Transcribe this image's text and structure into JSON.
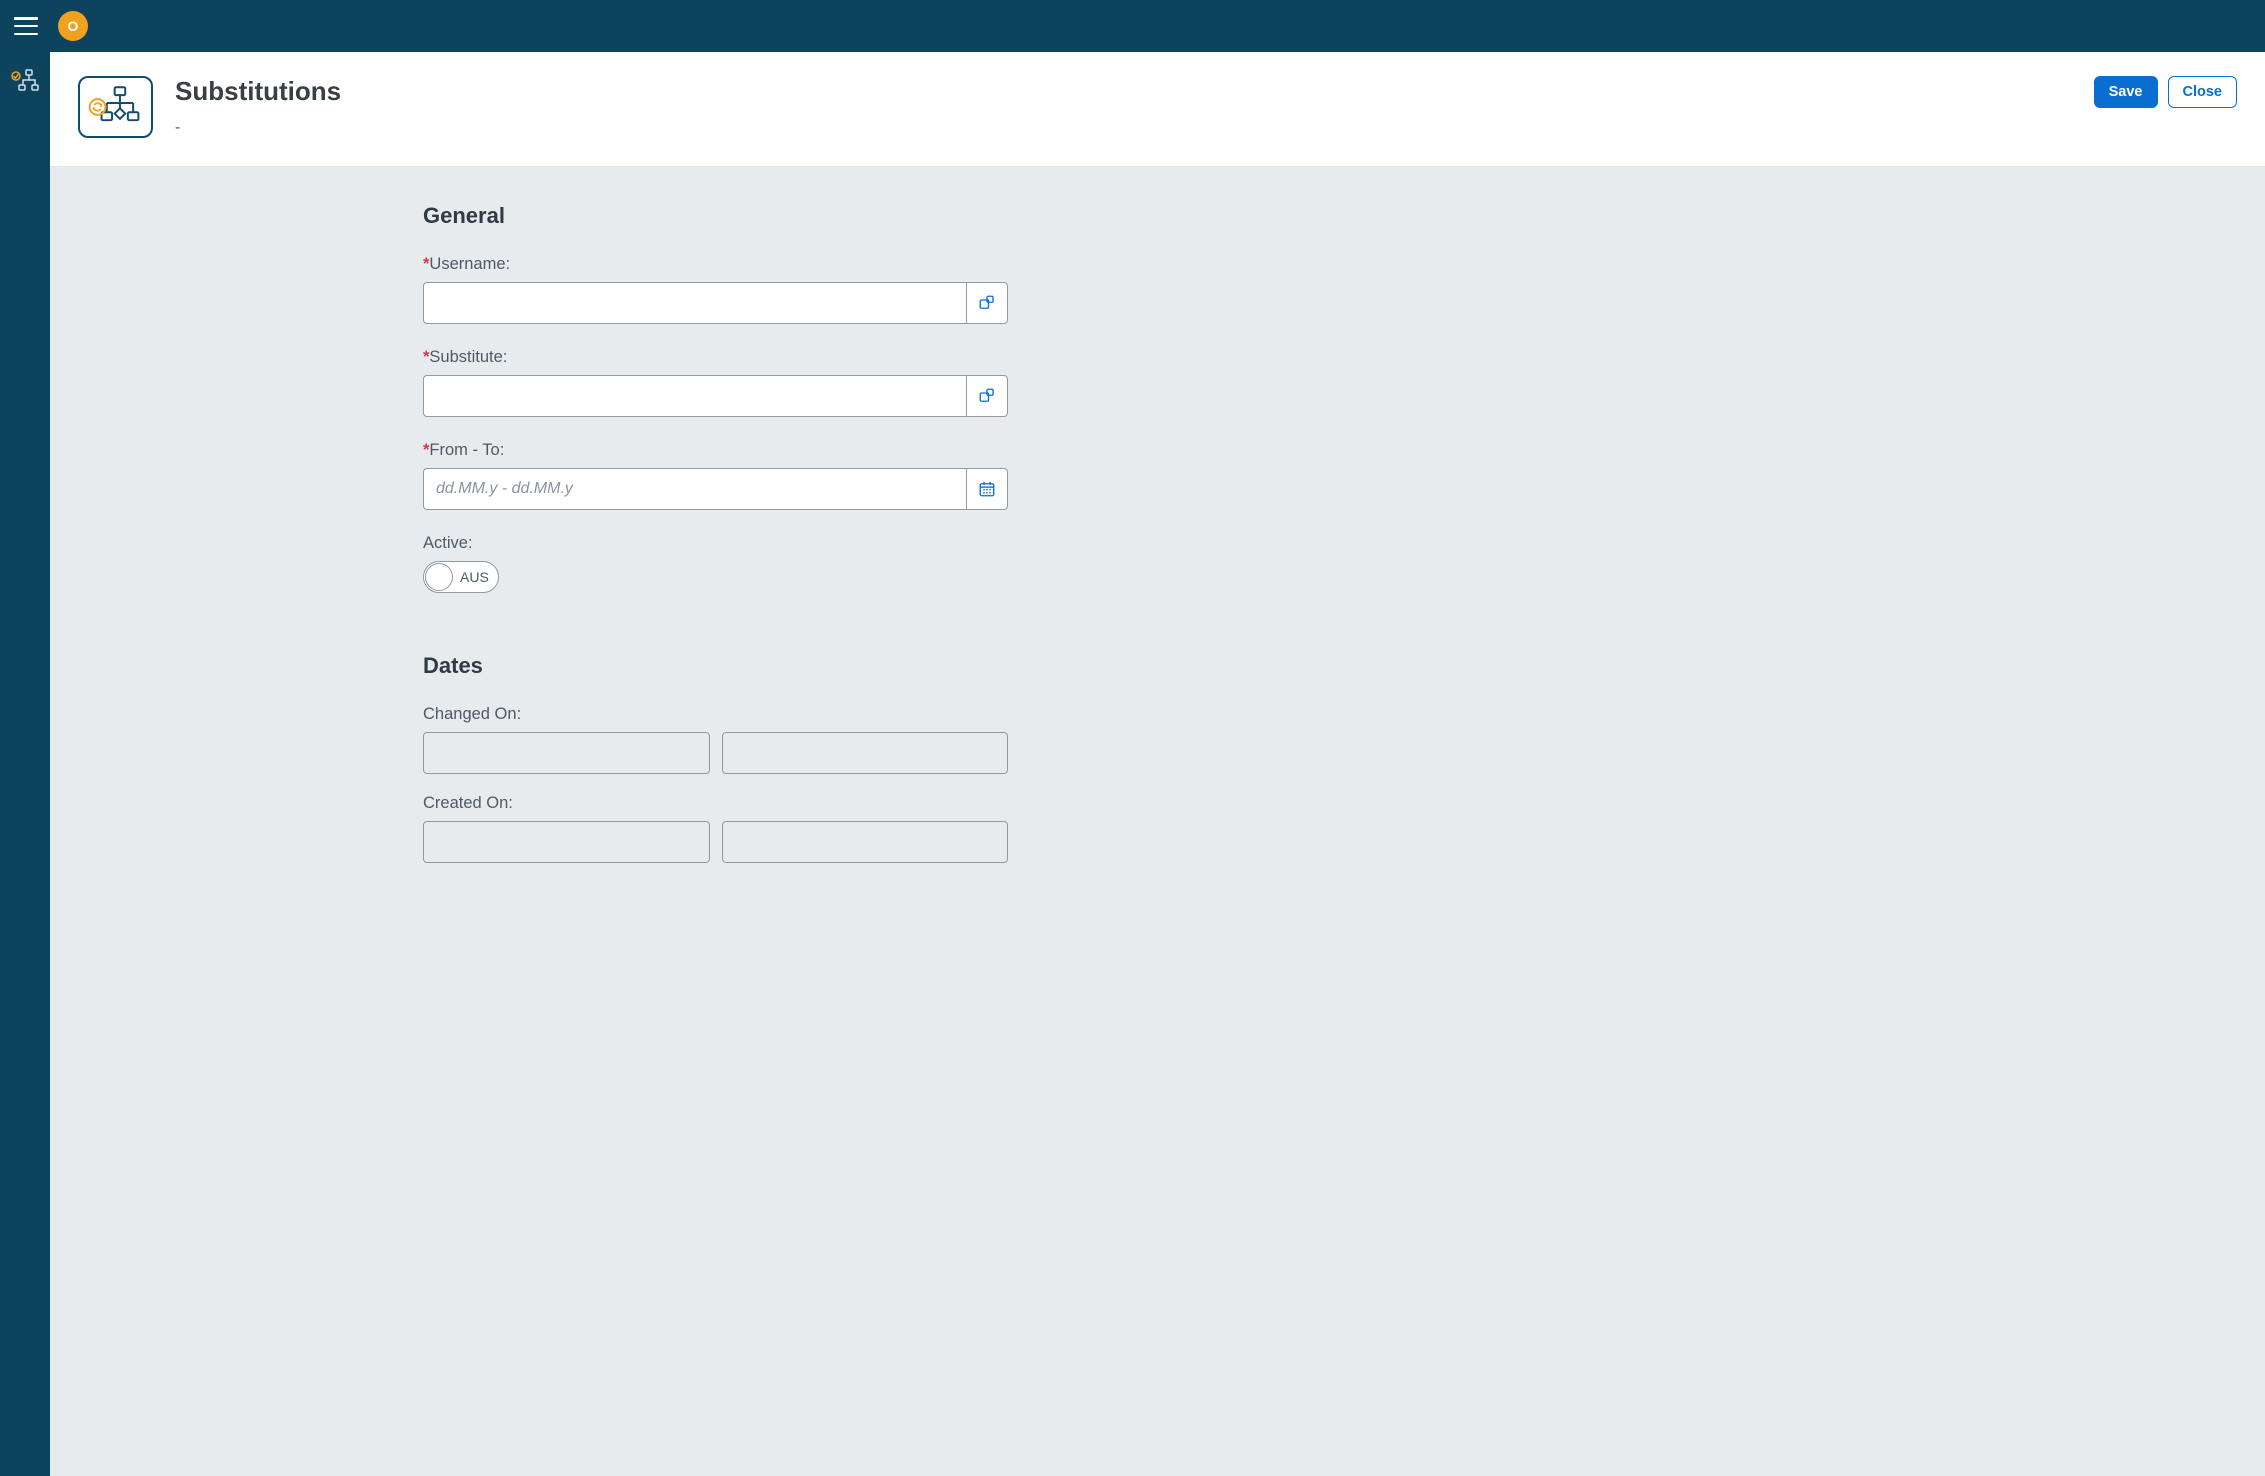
{
  "topbar": {
    "avatar_initial": "O"
  },
  "header": {
    "title": "Substitutions",
    "subtitle": "-",
    "save_label": "Save",
    "close_label": "Close"
  },
  "sections": {
    "general": {
      "title": "General",
      "username_label": "Username:",
      "username_value": "",
      "substitute_label": "Substitute:",
      "substitute_value": "",
      "fromto_label": "From - To:",
      "fromto_value": "",
      "fromto_placeholder": "dd.MM.y - dd.MM.y",
      "active_label": "Active:",
      "toggle_text": "AUS"
    },
    "dates": {
      "title": "Dates",
      "changed_on_label": "Changed On:",
      "changed_on_date": "",
      "changed_on_by": "",
      "created_on_label": "Created On:",
      "created_on_date": "",
      "created_on_by": ""
    }
  },
  "colors": {
    "brand_dark": "#0d435c",
    "primary": "#0a6ed1",
    "accent": "#f0a11e",
    "danger": "#d9364c"
  }
}
